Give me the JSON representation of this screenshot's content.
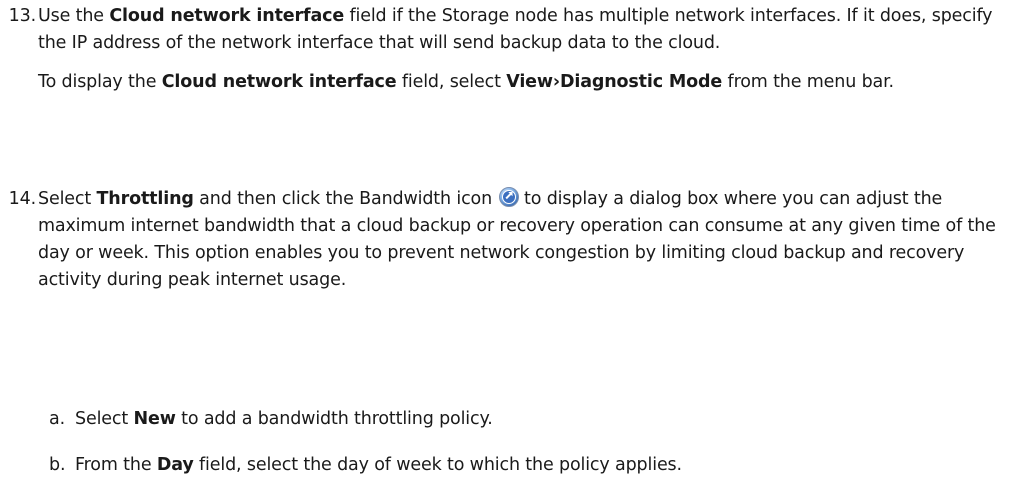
{
  "step13": {
    "number": "13.",
    "p1_t1": "Use the ",
    "p1_b1": "Cloud network interface",
    "p1_t2": " field if the Storage node has multiple network interfaces. If it does, specify the IP address of the network interface that will send backup data to the cloud.",
    "p2_t1": "To display the ",
    "p2_b1": "Cloud network interface",
    "p2_t2": " field, select ",
    "p2_b2": "View›Diagnostic Mode",
    "p2_t3": " from the menu bar."
  },
  "step14": {
    "number": "14.",
    "t1": "Select ",
    "b1": "Throttling",
    "t2": " and then click the Bandwidth icon",
    "icon": "bandwidth-icon",
    "t3": "to display a dialog box where you can adjust the maximum internet bandwidth that a cloud backup or recovery operation can consume at any given time of the day or week. This option enables you to prevent network congestion by limiting cloud backup and recovery activity during peak internet usage."
  },
  "substeps": [
    {
      "letter": "a.",
      "t1": "Select ",
      "b1": "New",
      "t2": " to add a bandwidth throttling policy."
    },
    {
      "letter": "b.",
      "t1": "From the ",
      "b1": "Day",
      "t2": " field, select the day of week to which the policy applies."
    }
  ]
}
